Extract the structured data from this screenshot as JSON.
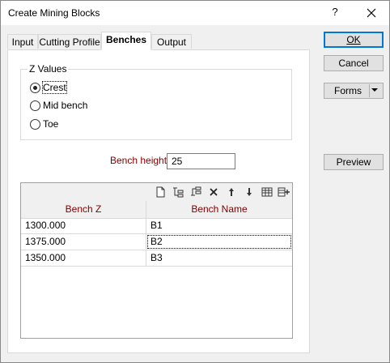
{
  "window": {
    "title": "Create Mining Blocks",
    "help_label": "?"
  },
  "tabs": [
    {
      "label": "Input"
    },
    {
      "label": "Cutting Profile"
    },
    {
      "label": "Benches"
    },
    {
      "label": "Output"
    }
  ],
  "active_tab": "Benches",
  "z_values": {
    "legend": "Z Values",
    "options": [
      {
        "label": "Crest",
        "checked": true
      },
      {
        "label": "Mid bench",
        "checked": false
      },
      {
        "label": "Toe",
        "checked": false
      }
    ]
  },
  "bench_height": {
    "label": "Bench height",
    "value": "25"
  },
  "grid": {
    "toolbar": [
      "new-row-icon",
      "insert-row-icon",
      "insert-rows-icon",
      "delete-row-icon",
      "move-up-icon",
      "move-down-icon",
      "table-editor-icon",
      "add-column-icon"
    ],
    "columns": [
      "Bench Z",
      "Bench Name"
    ],
    "rows": [
      [
        "1300.000",
        "B1"
      ],
      [
        "1375.000",
        "B2"
      ],
      [
        "1350.000",
        "B3"
      ]
    ]
  },
  "buttons": {
    "ok": "OK",
    "cancel": "Cancel",
    "forms": "Forms",
    "preview": "Preview"
  },
  "colors": {
    "label_accent": "#800000",
    "default_button": "#0078d7"
  }
}
